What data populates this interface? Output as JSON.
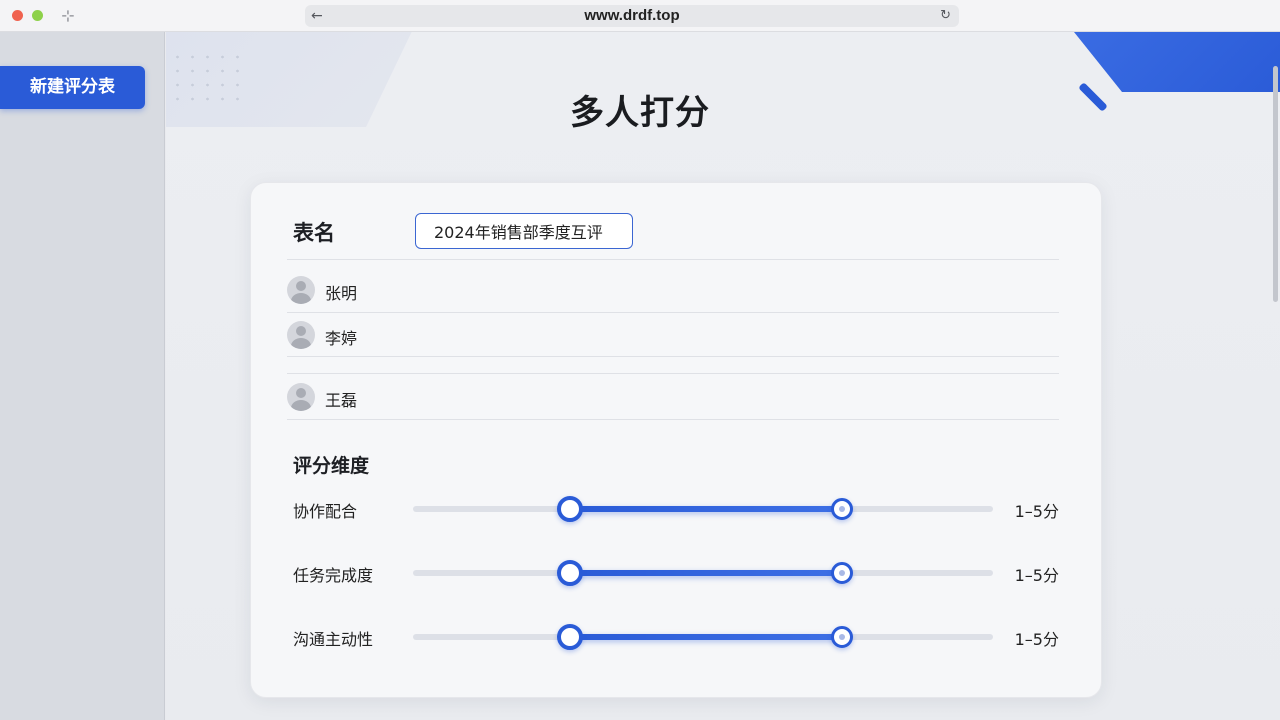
{
  "browser": {
    "url": "www.drdf.top",
    "back_icon": "←",
    "sidebar_icon": "⊹",
    "reload_icon": "↻"
  },
  "sidebar": {
    "new_button_label": "新建评分表"
  },
  "page": {
    "title": "多人打分"
  },
  "form": {
    "name_label": "表名",
    "name_value": "2024年销售部季度互评",
    "members": [
      {
        "name": "张明"
      },
      {
        "name": "李婷"
      },
      {
        "name": "王磊"
      }
    ],
    "dimensions_title": "评分维度",
    "dimensions": [
      {
        "label": "协作配合",
        "range_text": "1–5分",
        "min": 1,
        "max": 5,
        "low_fraction": 0.27,
        "high_fraction": 0.74
      },
      {
        "label": "任务完成度",
        "range_text": "1–5分",
        "min": 1,
        "max": 5,
        "low_fraction": 0.27,
        "high_fraction": 0.74
      },
      {
        "label": "沟通主动性",
        "range_text": "1–5分",
        "min": 1,
        "max": 5,
        "low_fraction": 0.27,
        "high_fraction": 0.74
      }
    ]
  },
  "colors": {
    "accent": "#2a5bd7",
    "close_dot": "#f0624f",
    "zoom_dot": "#8ed14a"
  }
}
